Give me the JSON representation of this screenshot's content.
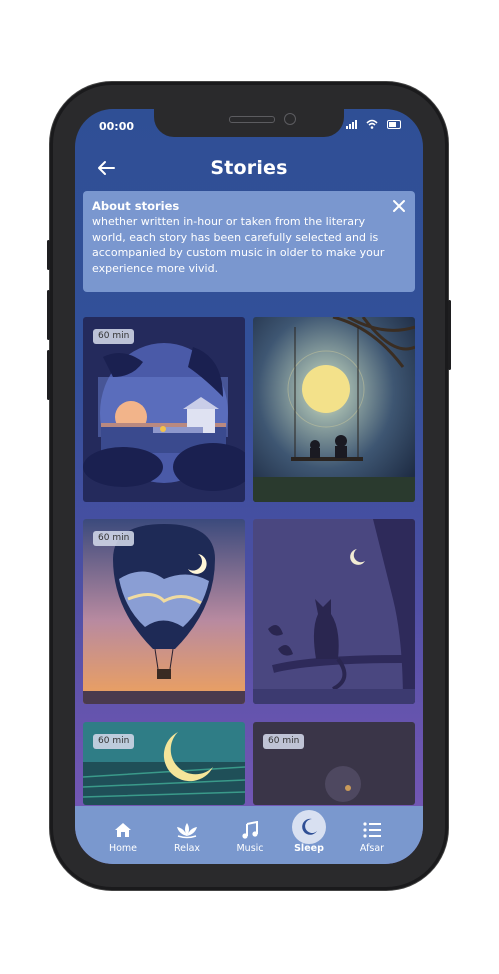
{
  "status_bar": {
    "time": "00:00"
  },
  "header": {
    "title": "Stories"
  },
  "about": {
    "title": "About stories",
    "text": "whether written in-hour or taken from the literary world, each story has been carefully selected and is accompanied by custom music in older to make your experience more vivid."
  },
  "stories": [
    {
      "duration": "60 min",
      "icon": "island-house-illustration"
    },
    {
      "duration": "",
      "icon": "swing-moon-illustration"
    },
    {
      "duration": "60 min",
      "icon": "hot-air-balloon-illustration"
    },
    {
      "duration": "",
      "icon": "cat-tree-moon-illustration"
    },
    {
      "duration": "60 min",
      "icon": "crescent-moon-field-illustration"
    },
    {
      "duration": "60 min",
      "icon": "dark-night-illustration"
    }
  ],
  "tabbar": {
    "items": [
      {
        "label": "Home",
        "icon": "home-icon"
      },
      {
        "label": "Relax",
        "icon": "lotus-icon"
      },
      {
        "label": "Music",
        "icon": "music-note-icon"
      },
      {
        "label": "Sleep",
        "icon": "moon-icon",
        "active": true
      },
      {
        "label": "Afsar",
        "icon": "list-icon"
      }
    ]
  },
  "colors": {
    "screen_top": "#2f4f95",
    "screen_bottom": "#7a59b8",
    "about_bg": "#7a97cf",
    "tabbar_bg": "#7a98ce",
    "active_tab_bg": "#d8e0f1"
  }
}
